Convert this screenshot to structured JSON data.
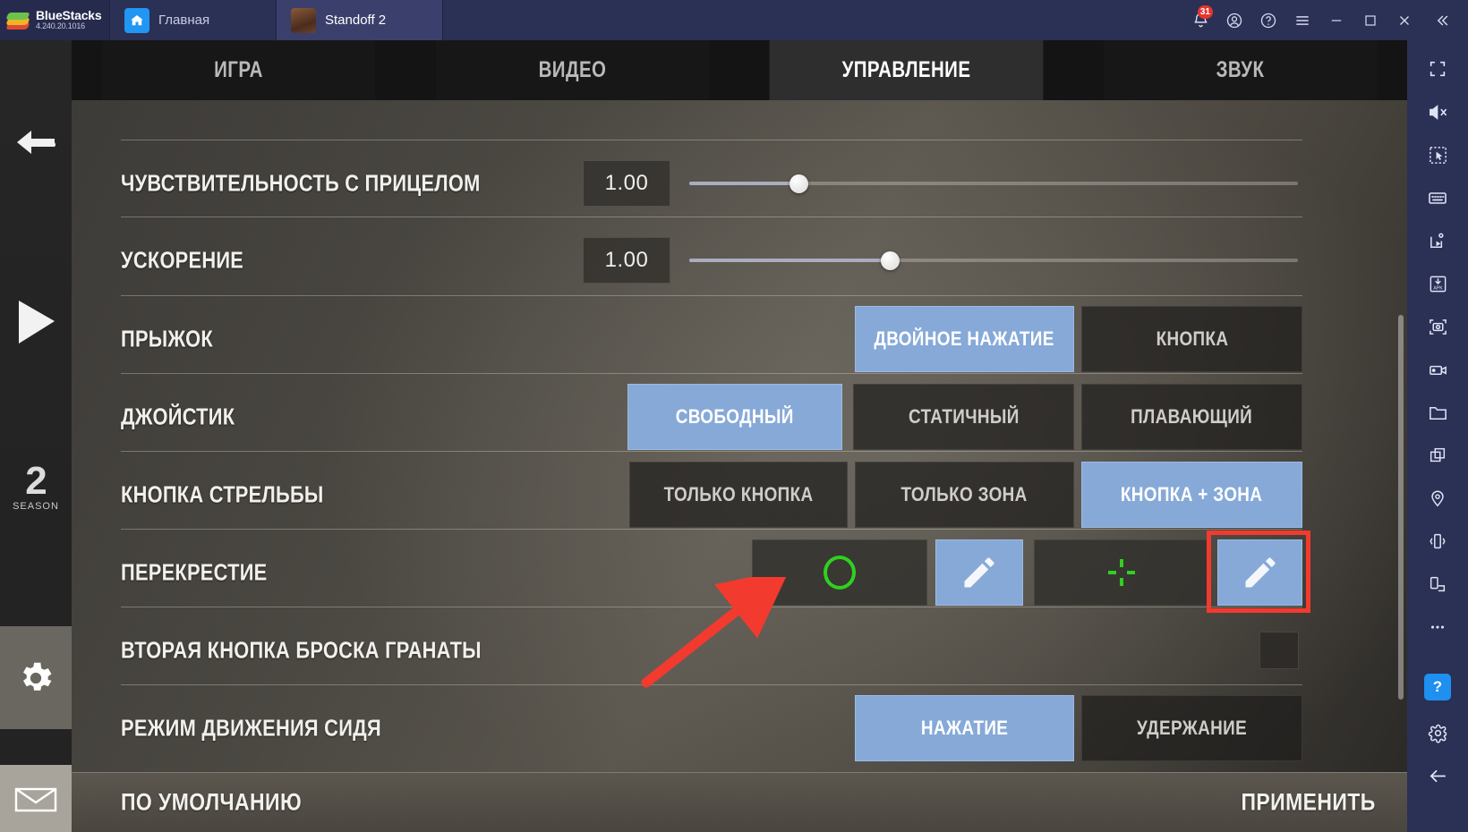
{
  "bluestacks": {
    "brand": "BlueStacks",
    "version": "4.240.20.1016",
    "tabs": [
      {
        "label": "Главная",
        "icon": "home-icon"
      },
      {
        "label": "Standoff 2",
        "icon": "game-app-icon"
      }
    ],
    "notification_count": "31",
    "window_actions": [
      "notifications-bell",
      "account",
      "help",
      "menu",
      "minimize",
      "maximize",
      "close",
      "collapse-sidebar"
    ],
    "sidetools": [
      "fullscreen-icon",
      "mute-icon",
      "cursor-select-icon",
      "keyboard-controls-icon",
      "macro-script-icon",
      "install-apk-icon",
      "screenshot-icon",
      "record-icon",
      "folder-icon",
      "multi-instance-icon",
      "location-icon",
      "shake-icon",
      "rotate-icon",
      "more-icon"
    ],
    "help_button_label": "?",
    "settings_icon": "gear-icon",
    "back_icon": "back-arrow-icon"
  },
  "game": {
    "sidebar": {
      "back_icon": "back-arrow-icon",
      "play_icon": "play-icon",
      "season_number": "2",
      "season_label": "SEASON",
      "settings_icon": "gear-icon",
      "mail_icon": "envelope-icon"
    },
    "tabs": [
      {
        "label": "ИГРА",
        "active": false
      },
      {
        "label": "ВИДЕО",
        "active": false
      },
      {
        "label": "УПРАВЛЕНИЕ",
        "active": true
      },
      {
        "label": "ЗВУК",
        "active": false
      }
    ],
    "rows": {
      "aim_sensitivity": {
        "label": "ЧУВСТВИТЕЛЬНОСТЬ С ПРИЦЕЛОМ",
        "value": "1.00",
        "slider_percent": 18
      },
      "acceleration": {
        "label": "УСКОРЕНИЕ",
        "value": "1.00",
        "slider_percent": 33
      },
      "jump": {
        "label": "ПРЫЖОК",
        "options": [
          {
            "label": "ДВОЙНОЕ НАЖАТИЕ",
            "selected": true
          },
          {
            "label": "КНОПКА",
            "selected": false
          }
        ]
      },
      "joystick": {
        "label": "ДЖОЙСТИК",
        "options": [
          {
            "label": "СВОБОДНЫЙ",
            "selected": true
          },
          {
            "label": "СТАТИЧНЫЙ",
            "selected": false
          },
          {
            "label": "ПЛАВАЮЩИЙ",
            "selected": false
          }
        ]
      },
      "fire_button": {
        "label": "КНОПКА СТРЕЛЬБЫ",
        "options": [
          {
            "label": "ТОЛЬКО КНОПКА",
            "selected": false
          },
          {
            "label": "ТОЛЬКО ЗОНА",
            "selected": false
          },
          {
            "label": "КНОПКА + ЗОНА",
            "selected": true
          }
        ]
      },
      "crosshair": {
        "label": "ПЕРЕКРЕСТИЕ",
        "cells": [
          {
            "icon": "crosshair-ring-icon",
            "style": "dark"
          },
          {
            "icon": "pencil-edit-icon",
            "style": "blue"
          },
          {
            "icon": "crosshair-cross-icon",
            "style": "dark"
          },
          {
            "icon": "pencil-edit-icon",
            "style": "blue",
            "highlighted": true
          }
        ]
      },
      "second_grenade_button": {
        "label": "ВТОРАЯ КНОПКА БРОСКА ГРАНАТЫ",
        "checkbox_checked": false
      },
      "crouch_move_mode": {
        "label": "РЕЖИМ ДВИЖЕНИЯ СИДЯ",
        "options": [
          {
            "label": "НАЖАТИЕ",
            "selected": true
          },
          {
            "label": "УДЕРЖАНИЕ",
            "selected": false
          }
        ]
      }
    },
    "footer": {
      "reset_label": "ПО УМОЛЧАНИЮ",
      "apply_label": "ПРИМЕНИТЬ"
    }
  },
  "annotation": {
    "highlight_color": "#f23a2e",
    "arrow": "red-arrow-pointer"
  },
  "colors": {
    "selected_option": "#86a9d8",
    "crosshair_green": "#2fd11f",
    "bluestacks_bar": "#2b3055",
    "badge_red": "#e8342c"
  }
}
